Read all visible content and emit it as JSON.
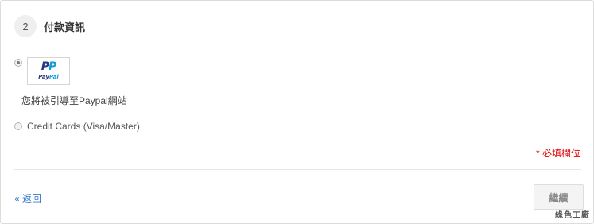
{
  "step": {
    "number": "2",
    "title": "付款資訊"
  },
  "payment_options": {
    "paypal": {
      "logo_mark_left": "P",
      "logo_mark_right": "P",
      "logo_word_left": "Pay",
      "logo_word_right": "Pal",
      "selected": true,
      "note": "您將被引導至Paypal網站"
    },
    "credit_card": {
      "label": "Credit Cards (Visa/Master)",
      "selected": false
    }
  },
  "required_note": "* 必填欄位",
  "footer": {
    "back_label": "« 返回",
    "continue_label": "繼續"
  },
  "watermark": "綠色工廠"
}
